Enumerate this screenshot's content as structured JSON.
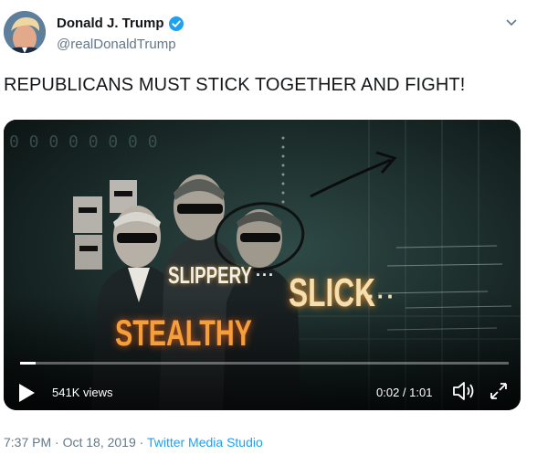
{
  "author": {
    "name": "Donald J. Trump",
    "handle": "@realDonaldTrump",
    "verified_color": "#1da1f2"
  },
  "tweet": {
    "text": "REPUBLICANS MUST STICK TOGETHER AND FIGHT!"
  },
  "video": {
    "overlay_words": {
      "slippery": "SLIPPERY",
      "slick": "SLICK",
      "stealthy": "STEALTHY",
      "slippery_dots": "···",
      "slick_dots": "···"
    },
    "views": "541K views",
    "time": "0:02 / 1:01",
    "progress_fraction": 0.032
  },
  "footer": {
    "timestamp": "7:37 PM · Oct 18, 2019 · ",
    "source": "Twitter Media Studio"
  },
  "icons": [
    "avatar",
    "verified-badge-icon",
    "chevron-down-icon",
    "play-icon",
    "volume-icon",
    "expand-icon"
  ]
}
